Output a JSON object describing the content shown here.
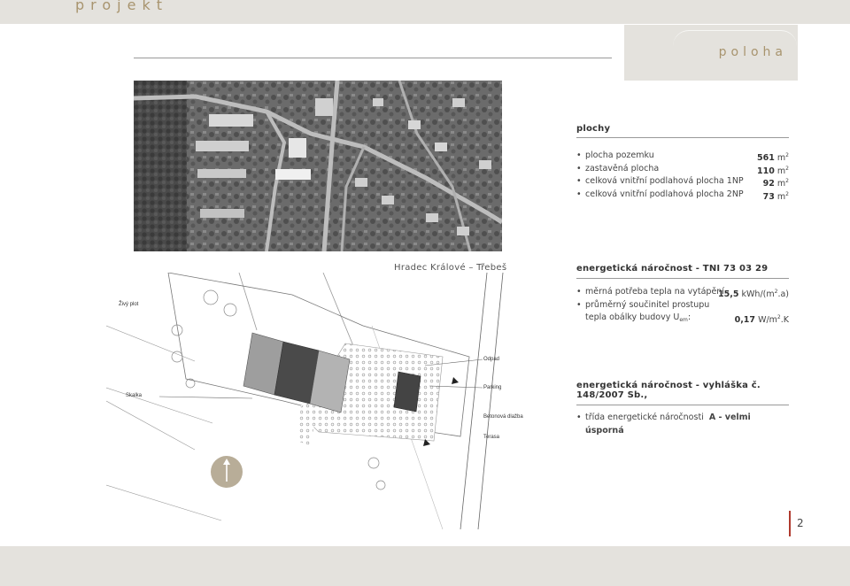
{
  "header": {
    "brand": "projekt"
  },
  "section": {
    "title": "poloha"
  },
  "map": {
    "caption": "Hradec Králové – Třebeš"
  },
  "plan_labels": {
    "zivy_plot": "Živý plot",
    "skalka": "Skalka",
    "odpad": "Odpad",
    "parking": "Parking",
    "betonova_dlazba": "Betonová dlažba",
    "terasa": "Terasa"
  },
  "plochy": {
    "heading": "plochy",
    "items": [
      {
        "label": "plocha pozemku",
        "value": "561",
        "unit": "m",
        "exp": "2"
      },
      {
        "label": "zastavěná plocha",
        "value": "110",
        "unit": "m",
        "exp": "2"
      },
      {
        "label": "celková vnitřní podlahová plocha 1NP",
        "value": "92",
        "unit": "m",
        "exp": "2"
      },
      {
        "label": "celková vnitřní podlahová plocha 2NP",
        "value": "73",
        "unit": "m",
        "exp": "2"
      }
    ]
  },
  "energy_tni": {
    "heading": "energetická náročnost - TNI 73 03 29",
    "item1_label": "měrná potřeba tepla na vytápění",
    "item1_value": "15,5",
    "item1_unit": "kWh/(m",
    "item1_exp": "2",
    "item1_tail": ".a)",
    "item2_line1": "průměrný součinitel prostupu",
    "item2_line2": "tepla obálky budovy U",
    "item2_sub": "em",
    "item2_colon": ":",
    "item2_value": "0,17",
    "item2_unit": "W/m",
    "item2_exp": "2",
    "item2_tail": ".K"
  },
  "energy_decree": {
    "heading": "energetická náročnost - vyhláška č. 148/2007 Sb.,",
    "item_label": "třída energetické náročnosti",
    "item_value": "A - velmi úsporná"
  },
  "page": {
    "number": "2"
  }
}
